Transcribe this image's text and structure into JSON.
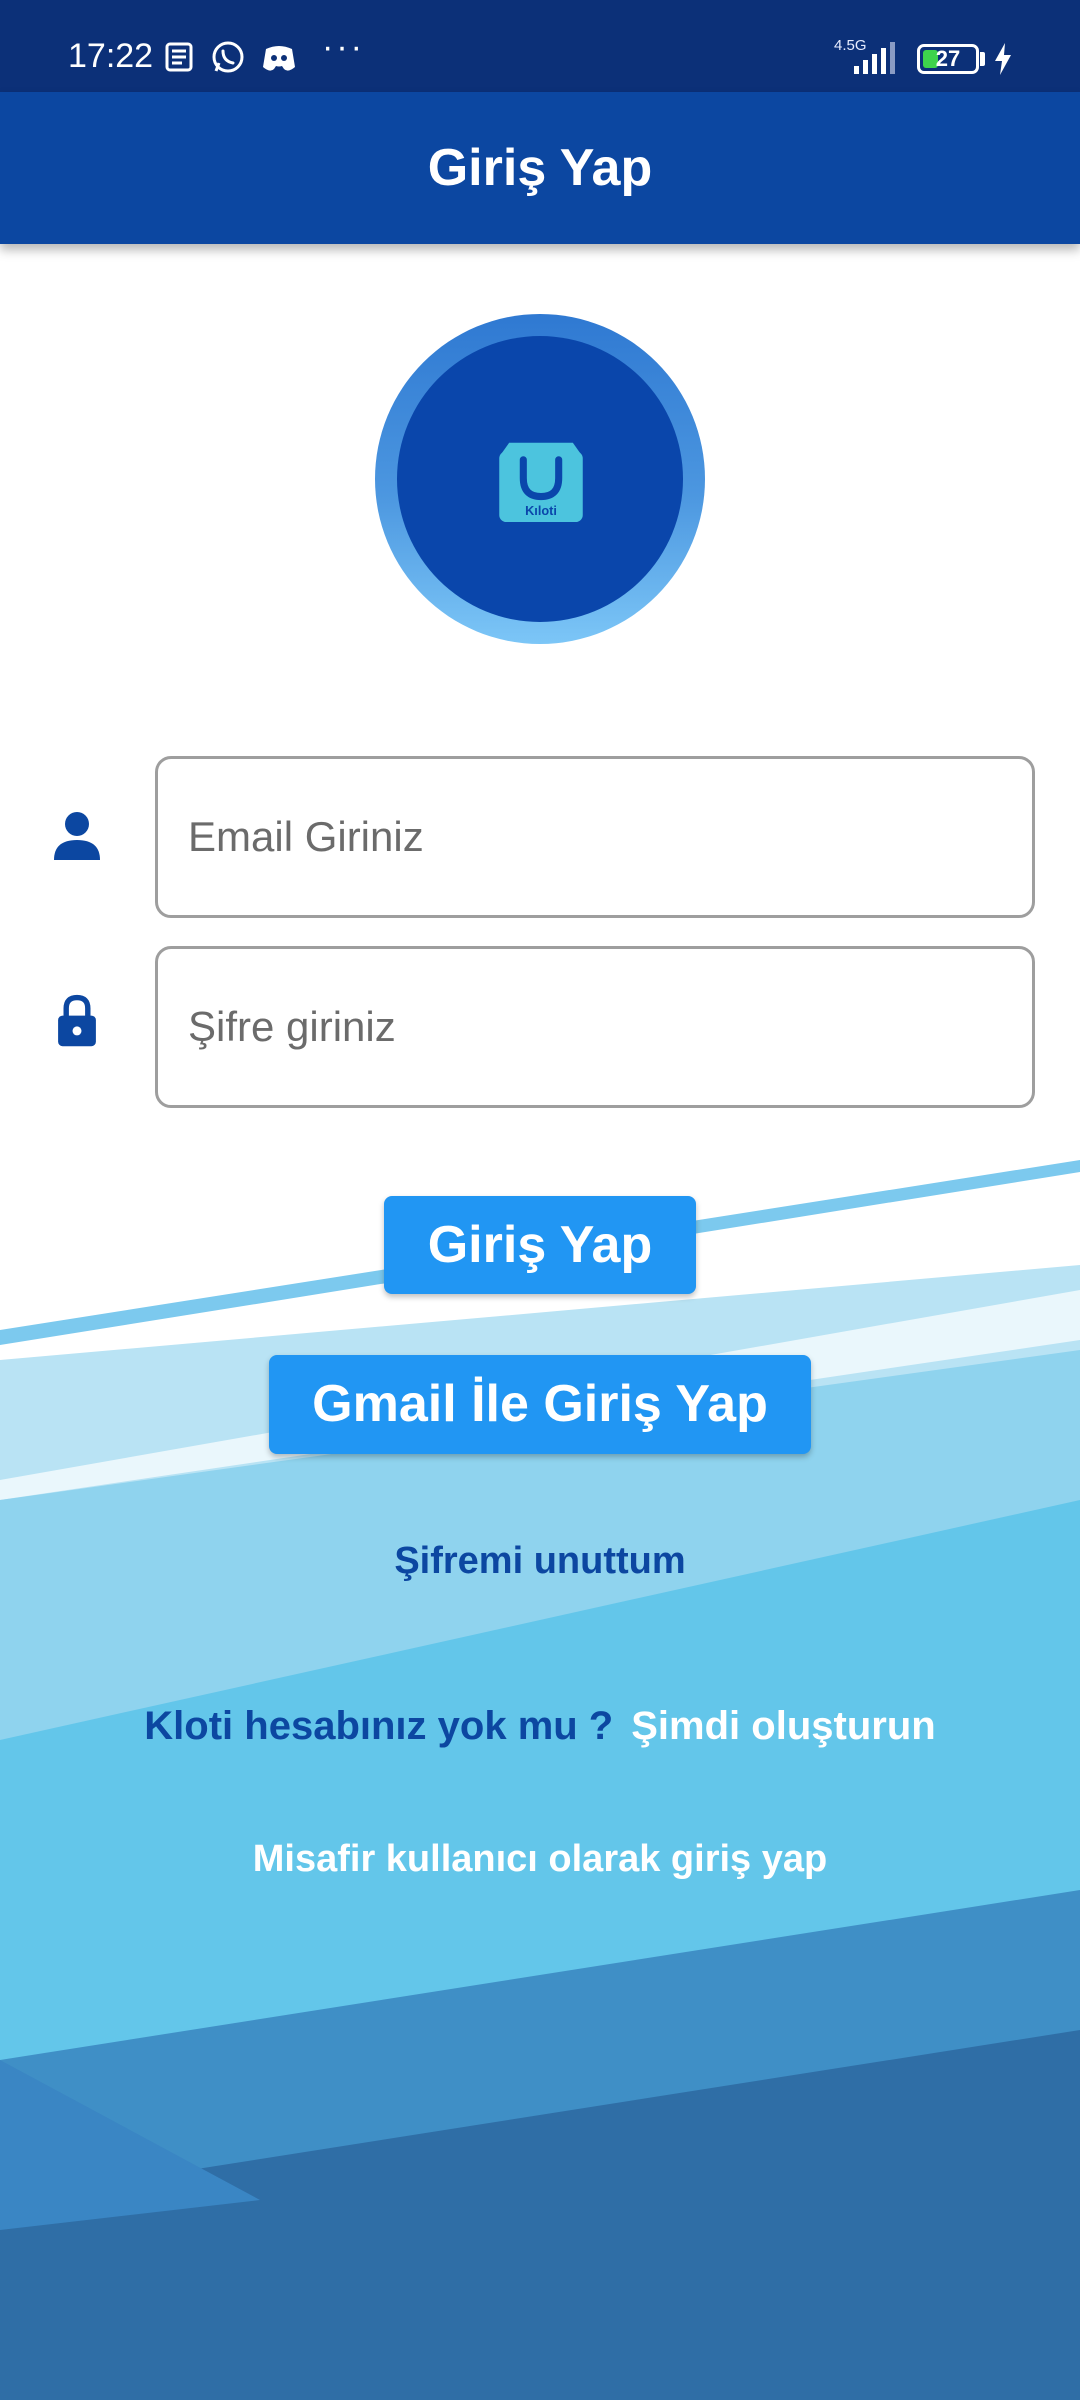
{
  "status_bar": {
    "time": "17:22",
    "network": "4.5G",
    "battery": "27",
    "icons": [
      "news-icon",
      "whatsapp-icon",
      "discord-icon",
      "more-dots",
      "signal-icon",
      "battery-icon",
      "charging-bolt-icon"
    ],
    "more": "···"
  },
  "app_bar": {
    "title": "Giriş Yap"
  },
  "logo": {
    "brand": "Kıloti"
  },
  "form": {
    "email_placeholder": "Email Giriniz",
    "password_placeholder": "Şifre giriniz"
  },
  "buttons": {
    "login": "Giriş Yap",
    "gmail": "Gmail İle Giriş Yap"
  },
  "links": {
    "forgot_password": "Şifremi unuttum",
    "no_account_question": "Kloti hesabınız yok mu ?",
    "create_now": "Şimdi oluşturun",
    "guest_login": "Misafir kullanıcı olarak giriş yap"
  },
  "colors": {
    "status_bar": "#0c3078",
    "app_bar": "#0c47a1",
    "button": "#2196f3",
    "link": "#0c47a1"
  }
}
